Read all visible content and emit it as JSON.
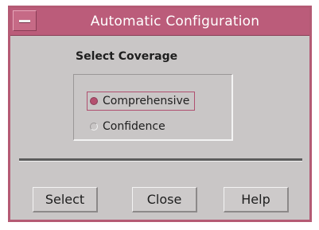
{
  "window": {
    "title": "Automatic Configuration",
    "title_bar_color": "#bb5c7a",
    "background_color": "#c9c6c6",
    "menu_icon": "window-menu-icon"
  },
  "coverage": {
    "label": "Select Coverage",
    "options": [
      {
        "label": "Comprehensive",
        "selected": true,
        "icon": "radio-selected-icon"
      },
      {
        "label": "Confidence",
        "selected": false,
        "icon": "radio-unselected-icon"
      }
    ]
  },
  "buttons": {
    "select_label": "Select",
    "close_label": "Close",
    "help_label": "Help"
  }
}
